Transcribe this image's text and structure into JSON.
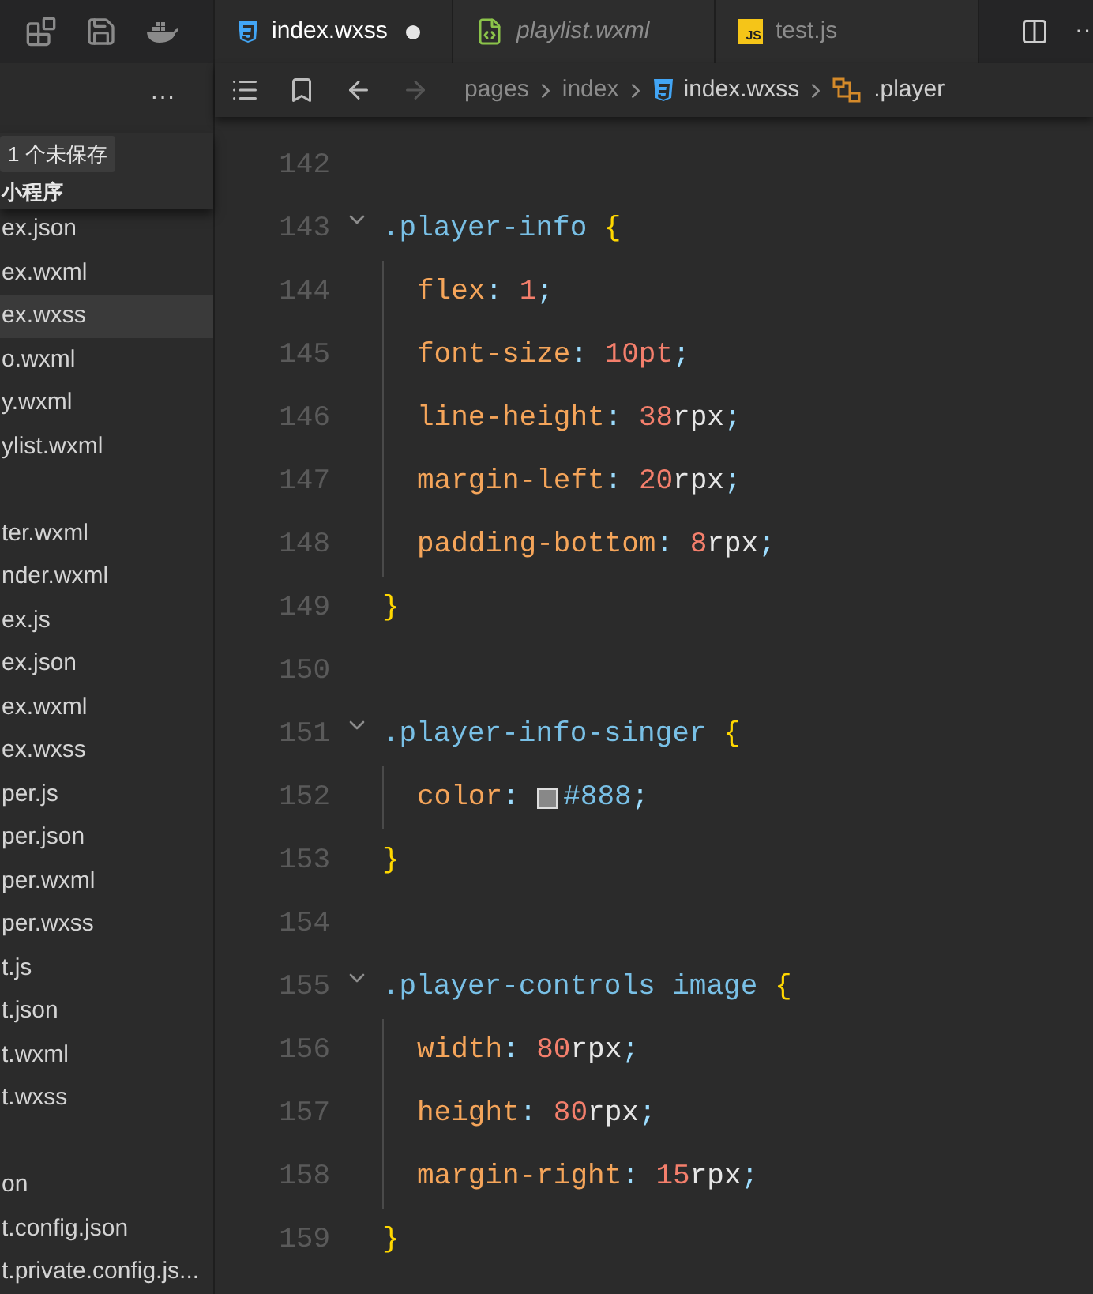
{
  "sidebar": {
    "more": "···",
    "unsaved_badge": "1 个未保存",
    "project": "小程序",
    "file_groups": [
      {
        "items": [
          {
            "label": "ex.json",
            "selected": false
          },
          {
            "label": "ex.wxml",
            "selected": false
          },
          {
            "label": "ex.wxss",
            "selected": true
          },
          {
            "label": "o.wxml",
            "selected": false
          },
          {
            "label": "y.wxml",
            "selected": false
          },
          {
            "label": "ylist.wxml",
            "selected": false
          }
        ]
      },
      {
        "items": [
          {
            "label": "ter.wxml",
            "selected": false
          },
          {
            "label": "nder.wxml",
            "selected": false
          },
          {
            "label": "ex.js",
            "selected": false
          },
          {
            "label": "ex.json",
            "selected": false
          },
          {
            "label": "ex.wxml",
            "selected": false
          },
          {
            "label": "ex.wxss",
            "selected": false
          },
          {
            "label": "per.js",
            "selected": false
          },
          {
            "label": "per.json",
            "selected": false
          },
          {
            "label": "per.wxml",
            "selected": false
          },
          {
            "label": "per.wxss",
            "selected": false
          },
          {
            "label": "t.js",
            "selected": false
          },
          {
            "label": "t.json",
            "selected": false
          },
          {
            "label": "t.wxml",
            "selected": false
          },
          {
            "label": "t.wxss",
            "selected": false
          }
        ]
      },
      {
        "items": [
          {
            "label": "on",
            "selected": false
          },
          {
            "label": "t.config.json",
            "selected": false
          },
          {
            "label": "t.private.config.js...",
            "selected": false
          }
        ]
      }
    ]
  },
  "tabs": [
    {
      "label": "index.wxss",
      "kind": "css",
      "selected": true,
      "modified": true,
      "preview": false
    },
    {
      "label": "playlist.wxml",
      "kind": "wxml",
      "selected": false,
      "modified": false,
      "preview": true
    },
    {
      "label": "test.js",
      "kind": "js",
      "badge": "JS",
      "selected": false,
      "modified": false,
      "preview": false
    }
  ],
  "tab_actions_more": "··",
  "breadcrumb": [
    {
      "label": "pages",
      "kind": "folder"
    },
    {
      "label": "index",
      "kind": "folder"
    },
    {
      "label": "index.wxss",
      "kind": "css"
    },
    {
      "label": ".player",
      "kind": "symbol"
    }
  ],
  "code_lines": [
    {
      "number": "142",
      "fold": false,
      "indented": false
    },
    {
      "number": "143",
      "fold": true,
      "indented": false,
      "tokens": [
        {
          "text": ".player-info",
          "kind": "selector"
        },
        {
          "text": " {",
          "kind": "brace"
        }
      ]
    },
    {
      "number": "144",
      "fold": false,
      "indented": true,
      "tokens": [
        {
          "text": "flex",
          "kind": "property"
        },
        {
          "text": ": ",
          "kind": "punct"
        },
        {
          "text": "1",
          "kind": "number"
        },
        {
          "text": ";",
          "kind": "punct"
        }
      ]
    },
    {
      "number": "145",
      "fold": false,
      "indented": true,
      "tokens": [
        {
          "text": "font-size",
          "kind": "property"
        },
        {
          "text": ": ",
          "kind": "punct"
        },
        {
          "text": "10pt",
          "kind": "number"
        },
        {
          "text": ";",
          "kind": "punct"
        }
      ]
    },
    {
      "number": "146",
      "fold": false,
      "indented": true,
      "tokens": [
        {
          "text": "line-height",
          "kind": "property"
        },
        {
          "text": ": ",
          "kind": "punct"
        },
        {
          "text": "38",
          "kind": "number"
        },
        {
          "text": "rpx",
          "kind": "unit"
        },
        {
          "text": ";",
          "kind": "punct"
        }
      ]
    },
    {
      "number": "147",
      "fold": false,
      "indented": true,
      "tokens": [
        {
          "text": "margin-left",
          "kind": "property"
        },
        {
          "text": ": ",
          "kind": "punct"
        },
        {
          "text": "20",
          "kind": "number"
        },
        {
          "text": "rpx",
          "kind": "unit"
        },
        {
          "text": ";",
          "kind": "punct"
        }
      ]
    },
    {
      "number": "148",
      "fold": false,
      "indented": true,
      "tokens": [
        {
          "text": "padding-bottom",
          "kind": "property"
        },
        {
          "text": ": ",
          "kind": "punct"
        },
        {
          "text": "8",
          "kind": "number"
        },
        {
          "text": "rpx",
          "kind": "unit"
        },
        {
          "text": ";",
          "kind": "punct"
        }
      ]
    },
    {
      "number": "149",
      "fold": false,
      "indented": false,
      "tokens": [
        {
          "text": "}",
          "kind": "brace"
        }
      ]
    },
    {
      "number": "150",
      "fold": false,
      "indented": false
    },
    {
      "number": "151",
      "fold": true,
      "indented": false,
      "tokens": [
        {
          "text": ".player-info-singer",
          "kind": "selector"
        },
        {
          "text": " {",
          "kind": "brace"
        }
      ]
    },
    {
      "number": "152",
      "fold": false,
      "indented": true,
      "tokens": [
        {
          "text": "color",
          "kind": "property"
        },
        {
          "text": ": ",
          "kind": "punct"
        },
        {
          "text": "#888",
          "kind": "colorvalue",
          "color": "#888888"
        },
        {
          "text": ";",
          "kind": "punct"
        }
      ]
    },
    {
      "number": "153",
      "fold": false,
      "indented": false,
      "tokens": [
        {
          "text": "}",
          "kind": "brace"
        }
      ]
    },
    {
      "number": "154",
      "fold": false,
      "indented": false
    },
    {
      "number": "155",
      "fold": true,
      "indented": false,
      "tokens": [
        {
          "text": ".player-controls image",
          "kind": "selector"
        },
        {
          "text": " {",
          "kind": "brace"
        }
      ]
    },
    {
      "number": "156",
      "fold": false,
      "indented": true,
      "tokens": [
        {
          "text": "width",
          "kind": "property"
        },
        {
          "text": ": ",
          "kind": "punct"
        },
        {
          "text": "80",
          "kind": "number"
        },
        {
          "text": "rpx",
          "kind": "unit"
        },
        {
          "text": ";",
          "kind": "punct"
        }
      ]
    },
    {
      "number": "157",
      "fold": false,
      "indented": true,
      "tokens": [
        {
          "text": "height",
          "kind": "property"
        },
        {
          "text": ": ",
          "kind": "punct"
        },
        {
          "text": "80",
          "kind": "number"
        },
        {
          "text": "rpx",
          "kind": "unit"
        },
        {
          "text": ";",
          "kind": "punct"
        }
      ]
    },
    {
      "number": "158",
      "fold": false,
      "indented": true,
      "tokens": [
        {
          "text": "margin-right",
          "kind": "property"
        },
        {
          "text": ": ",
          "kind": "punct"
        },
        {
          "text": "15",
          "kind": "number"
        },
        {
          "text": "rpx",
          "kind": "unit"
        },
        {
          "text": ";",
          "kind": "punct"
        }
      ]
    },
    {
      "number": "159",
      "fold": false,
      "indented": false,
      "tokens": [
        {
          "text": "}",
          "kind": "brace"
        }
      ]
    }
  ]
}
